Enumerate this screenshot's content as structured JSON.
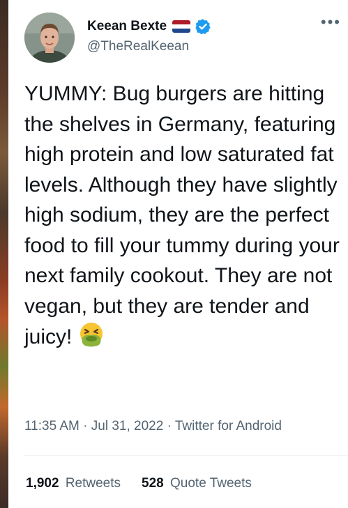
{
  "tweet": {
    "display_name": "Keean Bexte",
    "handle": "@TheRealKeean",
    "text": "YUMMY: Bug burgers are hitting the shelves in Germany, featuring high protein and low saturated fat levels. Although they have slightly high sodium, they are the perfect food to fill your tummy during your next family cookout. They are not vegan, but they are tender and juicy! ",
    "emoji": "nauseated-face",
    "time": "11:35 AM",
    "date": "Jul 31, 2022",
    "source": "Twitter for Android",
    "meta_sep": " · ",
    "more_label": "•••"
  },
  "stats": {
    "retweets_count": "1,902",
    "retweets_label": "Retweets",
    "quotes_count": "528",
    "quotes_label": "Quote Tweets"
  },
  "colors": {
    "text_primary": "#0f1419",
    "text_secondary": "#536471",
    "verified": "#1d9bf0",
    "flag_red": "#ae1c28",
    "flag_white": "#ffffff",
    "flag_blue": "#21468b"
  }
}
